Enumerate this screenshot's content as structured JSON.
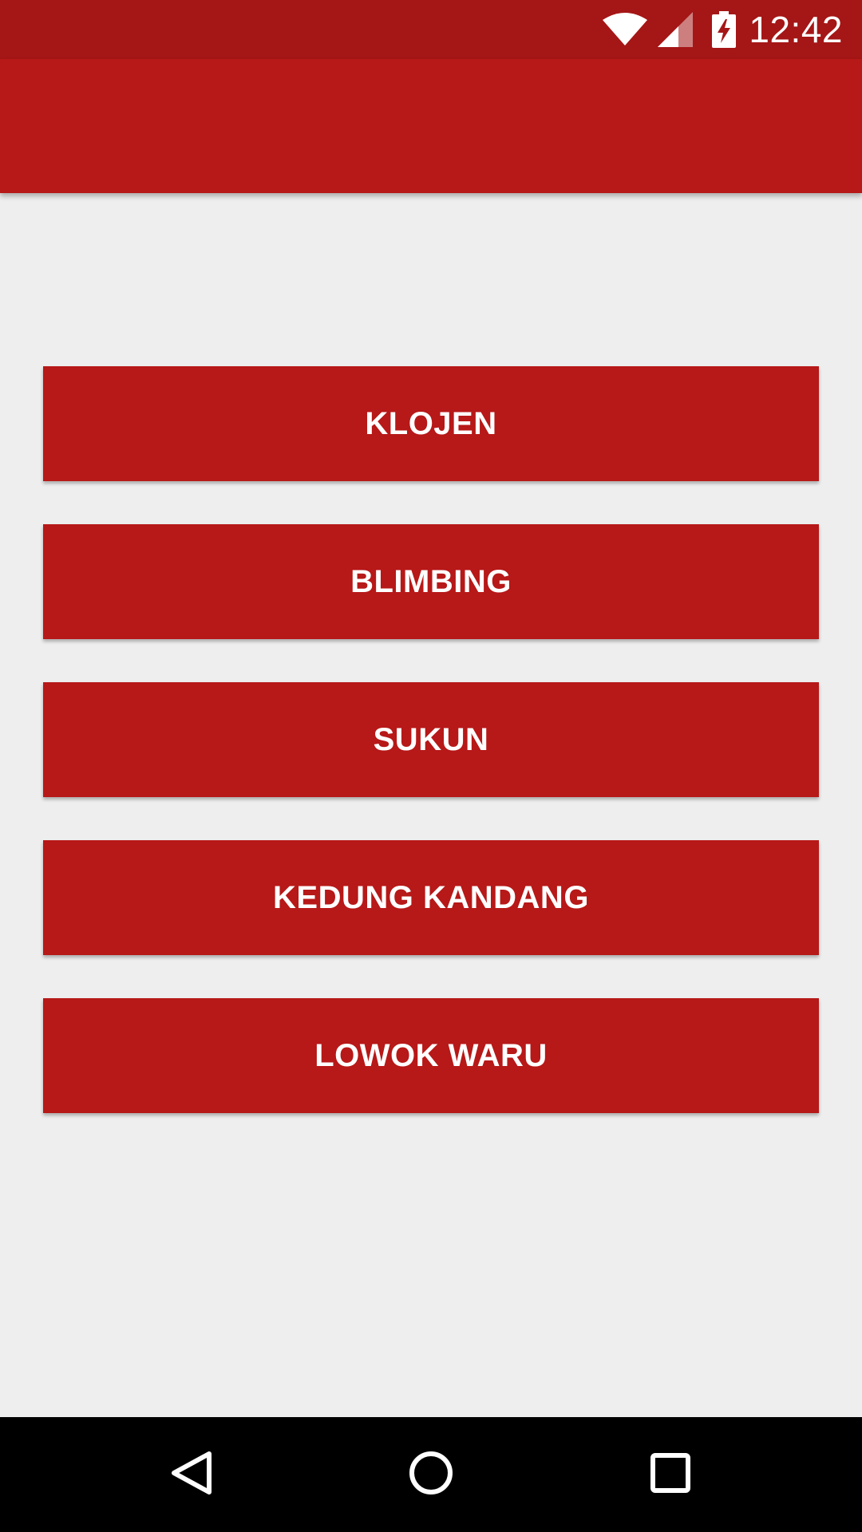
{
  "status_bar": {
    "time": "12:42",
    "icons": [
      "wifi-icon",
      "signal-icon",
      "battery-charging-icon"
    ],
    "background": "#a51616"
  },
  "app_bar": {
    "background": "#b71818"
  },
  "menu": {
    "buttons": [
      {
        "label": "KLOJEN"
      },
      {
        "label": "BLIMBING"
      },
      {
        "label": "SUKUN"
      },
      {
        "label": "KEDUNG KANDANG"
      },
      {
        "label": "LOWOK WARU"
      }
    ],
    "button_color": "#b71818",
    "text_color": "#ffffff"
  },
  "nav_bar": {
    "icons": [
      "back-icon",
      "home-icon",
      "recents-icon"
    ]
  }
}
